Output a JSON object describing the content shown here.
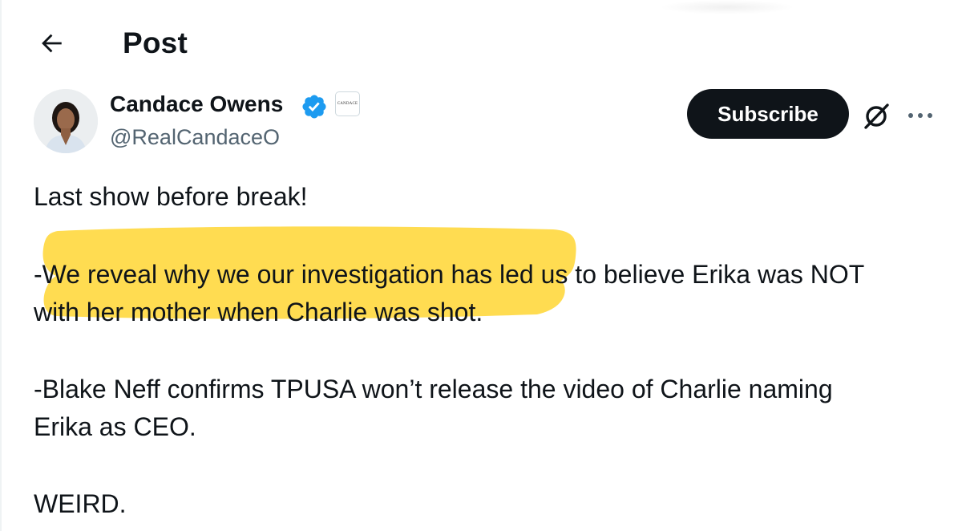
{
  "header": {
    "title": "Post",
    "back_icon": "arrow-left-icon"
  },
  "author": {
    "name": "Candace Owens",
    "handle": "@RealCandaceO",
    "verified_color": "#1d9bf0",
    "badge_text": "CANDACE"
  },
  "actions": {
    "subscribe_label": "Subscribe",
    "grok_icon": "grok-icon",
    "more_icon": "more-horizontal-icon"
  },
  "post": {
    "lines": [
      "Last show before break!",
      "-We reveal why we our investigation has led us to believe Erika was NOT",
      "with her mother when Charlie was shot.",
      "-Blake Neff confirms TPUSA won’t release the video of Charlie naming",
      "Erika as CEO.",
      "WEIRD."
    ],
    "highlight_color": "#ffd633"
  }
}
